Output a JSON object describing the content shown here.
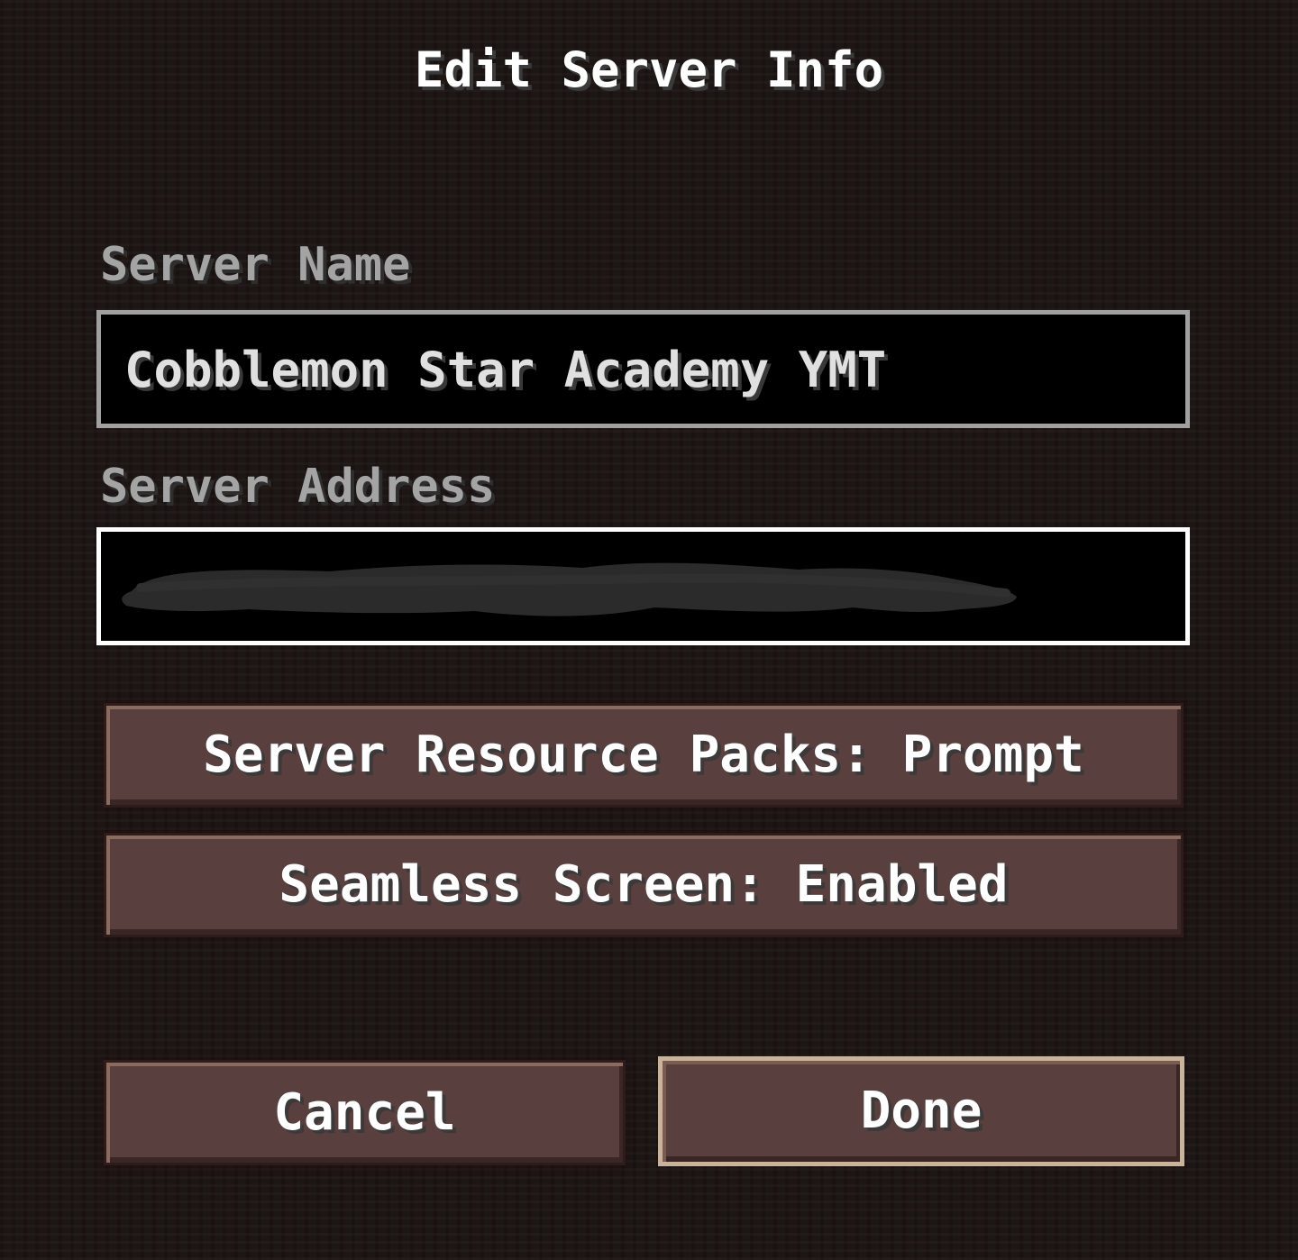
{
  "screen": {
    "title": "Edit Server Info"
  },
  "server_name": {
    "label": "Server Name",
    "value": "Cobblemon Star Academy YMT"
  },
  "server_address": {
    "label": "Server Address",
    "value": "",
    "redacted": true
  },
  "options": {
    "resource_packs_label": "Server Resource Packs: Prompt",
    "seamless_screen_label": "Seamless Screen: Enabled"
  },
  "actions": {
    "cancel_label": "Cancel",
    "done_label": "Done"
  },
  "colors": {
    "background": "#1b1412",
    "button_fill": "#5a3f3f",
    "button_hover_border": "#c9b39a",
    "field_border": "#a0a0a0",
    "field_border_focused": "#ffffff",
    "label_text": "#a4a4a4",
    "redaction": "#2b2b2b"
  }
}
